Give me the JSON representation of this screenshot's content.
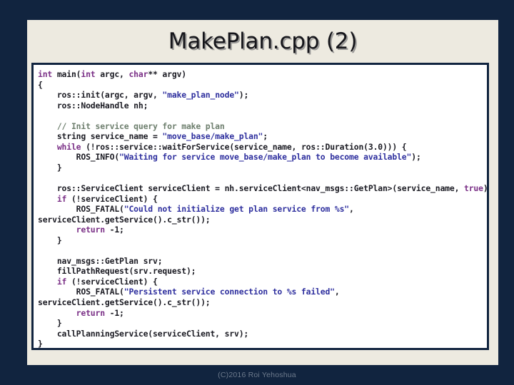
{
  "slide": {
    "title": "MakePlan.cpp (2)",
    "background_color": "#11243f",
    "panel_color": "#edeae0"
  },
  "footer": {
    "text": "(C)2016 Roi Yehoshua"
  },
  "code_block": {
    "language": "cpp",
    "background_color": "#ffffff",
    "border_color": "#11243f",
    "colors": {
      "keyword": "#7a2f86",
      "string": "#2e2f9e",
      "comment": "#6d7e6d",
      "plain": "#1a1a22"
    },
    "lines": [
      "int main(int argc, char** argv)",
      "{",
      "    ros::init(argc, argv, \"make_plan_node\");",
      "    ros::NodeHandle nh;",
      "",
      "    // Init service query for make plan",
      "    string service_name = \"move_base/make_plan\";",
      "    while (!ros::service::waitForService(service_name, ros::Duration(3.0))) {",
      "        ROS_INFO(\"Waiting for service move_base/make_plan to become available\");",
      "    }",
      "",
      "    ros::ServiceClient serviceClient = nh.serviceClient<nav_msgs::GetPlan>(service_name, true);",
      "    if (!serviceClient) {",
      "        ROS_FATAL(\"Could not initialize get plan service from %s\",",
      "serviceClient.getService().c_str());",
      "        return -1;",
      "    }",
      "",
      "    nav_msgs::GetPlan srv;",
      "    fillPathRequest(srv.request);",
      "    if (!serviceClient) {",
      "        ROS_FATAL(\"Persistent service connection to %s failed\",",
      "serviceClient.getService().c_str());",
      "        return -1;",
      "    }",
      "    callPlanningService(serviceClient, srv);",
      "}"
    ],
    "tokens": [
      [
        {
          "t": "int",
          "c": "kw"
        },
        {
          "t": " main(",
          "c": "pln"
        },
        {
          "t": "int",
          "c": "kw"
        },
        {
          "t": " argc, ",
          "c": "pln"
        },
        {
          "t": "char",
          "c": "kw"
        },
        {
          "t": "** argv)",
          "c": "pln"
        }
      ],
      [
        {
          "t": "{",
          "c": "pln"
        }
      ],
      [
        {
          "t": "    ros::init(argc, argv, ",
          "c": "pln"
        },
        {
          "t": "\"make_plan_node\"",
          "c": "str"
        },
        {
          "t": ");",
          "c": "pln"
        }
      ],
      [
        {
          "t": "    ros::NodeHandle nh;",
          "c": "pln"
        }
      ],
      [
        {
          "t": "",
          "c": "pln"
        }
      ],
      [
        {
          "t": "    // Init service query for make plan",
          "c": "cmt"
        }
      ],
      [
        {
          "t": "    string service_name = ",
          "c": "pln"
        },
        {
          "t": "\"move_base/make_plan\"",
          "c": "str"
        },
        {
          "t": ";",
          "c": "pln"
        }
      ],
      [
        {
          "t": "    ",
          "c": "pln"
        },
        {
          "t": "while",
          "c": "kw"
        },
        {
          "t": " (!ros::service::waitForService(service_name, ros::Duration(3.0))) {",
          "c": "pln"
        }
      ],
      [
        {
          "t": "        ROS_INFO(",
          "c": "pln"
        },
        {
          "t": "\"Waiting for service move_base/make_plan to become available\"",
          "c": "str"
        },
        {
          "t": ");",
          "c": "pln"
        }
      ],
      [
        {
          "t": "    }",
          "c": "pln"
        }
      ],
      [
        {
          "t": "",
          "c": "pln"
        }
      ],
      [
        {
          "t": "    ros::ServiceClient serviceClient = nh.serviceClient<nav_msgs::GetPlan>(service_name, ",
          "c": "pln"
        },
        {
          "t": "true",
          "c": "kw"
        },
        {
          "t": ");",
          "c": "pln"
        }
      ],
      [
        {
          "t": "    ",
          "c": "pln"
        },
        {
          "t": "if",
          "c": "kw"
        },
        {
          "t": " (!serviceClient) {",
          "c": "pln"
        }
      ],
      [
        {
          "t": "        ROS_FATAL(",
          "c": "pln"
        },
        {
          "t": "\"Could not initialize get plan service from %s\"",
          "c": "str"
        },
        {
          "t": ",",
          "c": "pln"
        }
      ],
      [
        {
          "t": "serviceClient.getService().c_str());",
          "c": "pln"
        }
      ],
      [
        {
          "t": "        ",
          "c": "pln"
        },
        {
          "t": "return",
          "c": "kw"
        },
        {
          "t": " -1;",
          "c": "pln"
        }
      ],
      [
        {
          "t": "    }",
          "c": "pln"
        }
      ],
      [
        {
          "t": "",
          "c": "pln"
        }
      ],
      [
        {
          "t": "    nav_msgs::GetPlan srv;",
          "c": "pln"
        }
      ],
      [
        {
          "t": "    fillPathRequest(srv.request);",
          "c": "pln"
        }
      ],
      [
        {
          "t": "    ",
          "c": "pln"
        },
        {
          "t": "if",
          "c": "kw"
        },
        {
          "t": " (!serviceClient) {",
          "c": "pln"
        }
      ],
      [
        {
          "t": "        ROS_FATAL(",
          "c": "pln"
        },
        {
          "t": "\"Persistent service connection to %s failed\"",
          "c": "str"
        },
        {
          "t": ",",
          "c": "pln"
        }
      ],
      [
        {
          "t": "serviceClient.getService().c_str());",
          "c": "pln"
        }
      ],
      [
        {
          "t": "        ",
          "c": "pln"
        },
        {
          "t": "return",
          "c": "kw"
        },
        {
          "t": " -1;",
          "c": "pln"
        }
      ],
      [
        {
          "t": "    }",
          "c": "pln"
        }
      ],
      [
        {
          "t": "    callPlanningService(serviceClient, srv);",
          "c": "pln"
        }
      ],
      [
        {
          "t": "}",
          "c": "pln"
        }
      ]
    ]
  }
}
